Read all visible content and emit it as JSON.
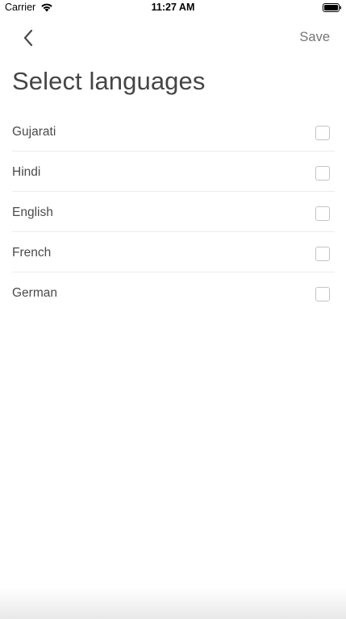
{
  "status_bar": {
    "carrier": "Carrier",
    "time": "11:27 AM",
    "wifi_icon": "wifi-icon",
    "battery_icon": "battery-icon"
  },
  "nav": {
    "back_icon": "chevron-left-icon",
    "save_label": "Save"
  },
  "page": {
    "title": "Select languages"
  },
  "languages": [
    {
      "label": "Gujarati",
      "checked": false
    },
    {
      "label": "Hindi",
      "checked": false
    },
    {
      "label": "English",
      "checked": false
    },
    {
      "label": "French",
      "checked": false
    },
    {
      "label": "German",
      "checked": false
    }
  ],
  "colors": {
    "title": "#454545",
    "label": "#4a4a4a",
    "save": "#757575",
    "divider": "#ececec",
    "checkbox_border": "#c4c4c4"
  }
}
